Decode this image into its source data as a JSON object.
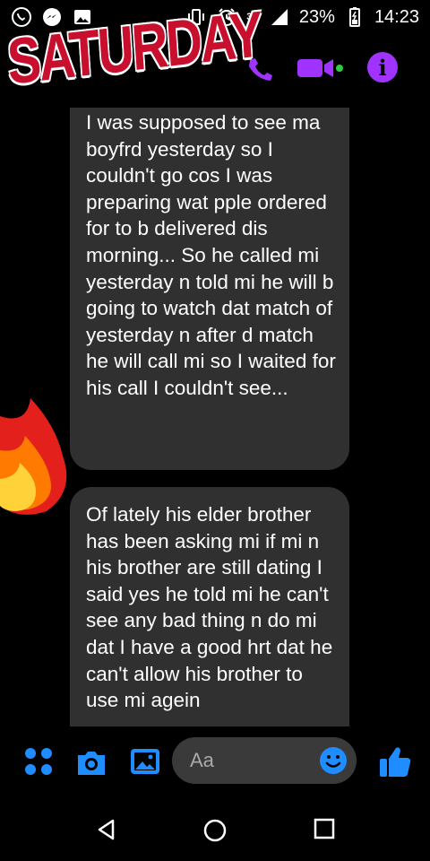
{
  "status_bar": {
    "network_label": "3G",
    "battery": "23%",
    "time": "14:23"
  },
  "header": {
    "sticker_text": "SATURDAY",
    "info_glyph": "i"
  },
  "messages": [
    {
      "text": "I was supposed to see ma boyfrd yesterday so I couldn't go cos I was preparing wat pple ordered for to b delivered dis morning... So he called mi yesterday n told mi he will b going to watch dat match of yesterday n after d match he will call mi so I waited for his call I couldn't see..."
    },
    {
      "text": "Of lately his elder brother has been asking mi if mi n his brother are still dating I said yes he told mi he can't see any bad thing n do mi dat I have a good hrt dat he can't allow his brother to use mi agein"
    }
  ],
  "composer": {
    "placeholder": "Aa"
  },
  "icons": {
    "whatsapp": "whatsapp-icon",
    "messenger": "messenger-icon",
    "gallery_notif": "image-icon",
    "vibrate": "vibrate-icon",
    "alarm": "alarm-icon",
    "signal": "signal-icon",
    "battery": "battery-icon",
    "call": "phone-icon",
    "video": "video-camera-icon",
    "info": "info-icon",
    "menu": "four-dots-icon",
    "camera": "camera-icon",
    "gallery": "gallery-icon",
    "emoji": "emoji-icon",
    "like": "thumbs-up-icon",
    "fire": "fire-icon",
    "back": "back-icon",
    "home": "home-icon",
    "recents": "recents-icon"
  },
  "colors": {
    "accent_purple": "#a033ff",
    "accent_blue": "#1f8cff",
    "bubble_bg": "#303030",
    "background": "#000000",
    "sticker_red": "#c8102e"
  }
}
